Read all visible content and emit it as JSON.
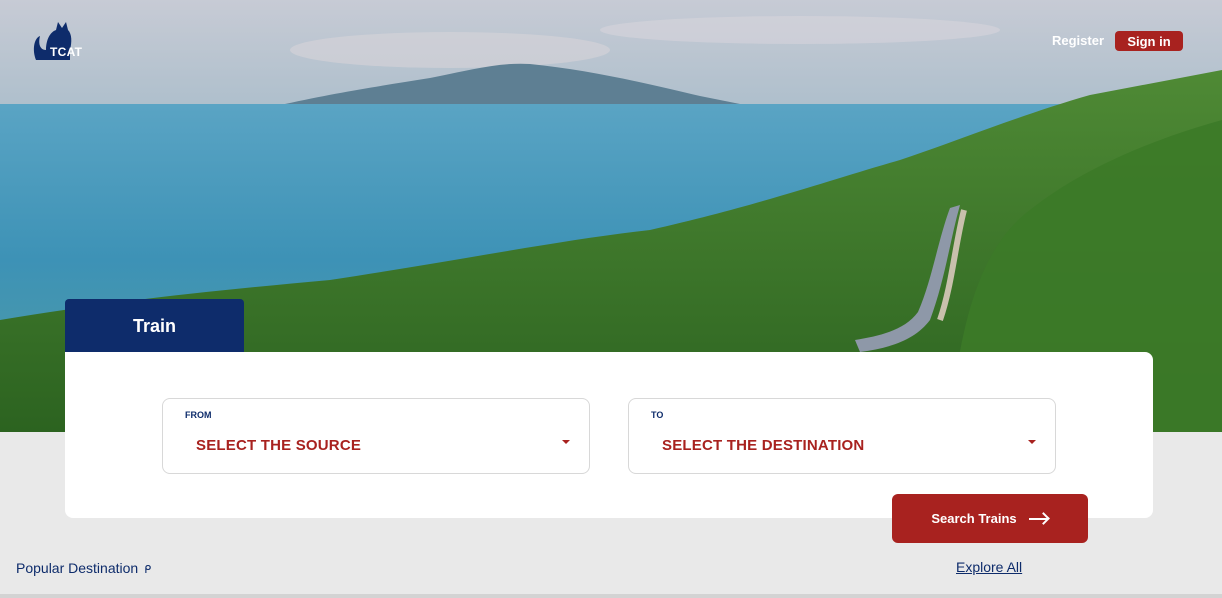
{
  "brand": {
    "logo_text": "TCAT"
  },
  "header": {
    "register_label": "Register",
    "signin_label": "Sign in"
  },
  "search": {
    "tab_label": "Train",
    "from": {
      "label": "FROM",
      "value": "SELECT THE SOURCE"
    },
    "to": {
      "label": "TO",
      "value": "SELECT THE DESTINATION"
    },
    "button_label": "Search Trains"
  },
  "popular": {
    "label": "Popular Destination",
    "pin_icon": "ᑭ",
    "explore_label": "Explore All"
  },
  "colors": {
    "primary_red": "#a8221f",
    "navy": "#0e2c6b"
  },
  "icons": [
    "cat-logo-icon",
    "chevron-down-icon",
    "arrow-right-icon",
    "pin-icon"
  ]
}
